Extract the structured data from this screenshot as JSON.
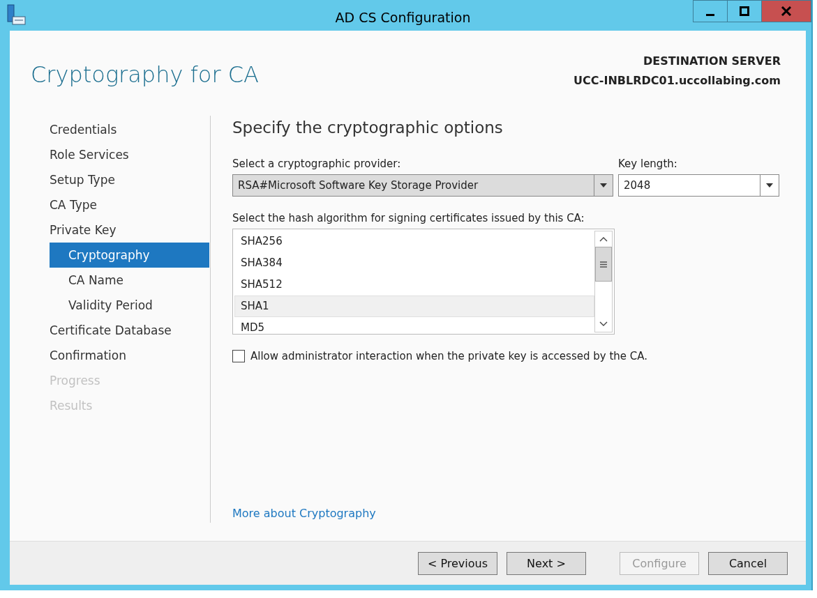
{
  "window": {
    "title": "AD CS Configuration"
  },
  "header": {
    "page_title": "Cryptography for CA",
    "destination_label": "DESTINATION SERVER",
    "server_name": "UCC-INBLRDC01.uccollabing.com"
  },
  "sidebar": {
    "items": [
      {
        "label": "Credentials",
        "selected": false,
        "disabled": false
      },
      {
        "label": "Role Services",
        "selected": false,
        "disabled": false
      },
      {
        "label": "Setup Type",
        "selected": false,
        "disabled": false
      },
      {
        "label": "CA Type",
        "selected": false,
        "disabled": false
      },
      {
        "label": "Private Key",
        "selected": false,
        "disabled": false,
        "children": [
          {
            "label": "Cryptography",
            "selected": true,
            "disabled": false
          },
          {
            "label": "CA Name",
            "selected": false,
            "disabled": false
          },
          {
            "label": "Validity Period",
            "selected": false,
            "disabled": false
          }
        ]
      },
      {
        "label": "Certificate Database",
        "selected": false,
        "disabled": false
      },
      {
        "label": "Confirmation",
        "selected": false,
        "disabled": false
      },
      {
        "label": "Progress",
        "selected": false,
        "disabled": true
      },
      {
        "label": "Results",
        "selected": false,
        "disabled": true
      }
    ]
  },
  "content": {
    "heading": "Specify the cryptographic options",
    "provider": {
      "label": "Select a cryptographic provider:",
      "value": "RSA#Microsoft Software Key Storage Provider"
    },
    "key_length": {
      "label": "Key length:",
      "value": "2048"
    },
    "hash": {
      "label": "Select the hash algorithm for signing certificates issued by this CA:",
      "items": [
        {
          "label": "SHA256",
          "selected": false
        },
        {
          "label": "SHA384",
          "selected": false
        },
        {
          "label": "SHA512",
          "selected": false
        },
        {
          "label": "SHA1",
          "selected": true
        },
        {
          "label": "MD5",
          "selected": false
        }
      ]
    },
    "allow_interaction": {
      "label": "Allow administrator interaction when the private key is accessed by the CA.",
      "checked": false
    },
    "link": "More about Cryptography"
  },
  "buttons": [
    {
      "label": "< Previous",
      "disabled": false
    },
    {
      "label": "Next >",
      "disabled": false
    },
    {
      "label": "Configure",
      "disabled": true
    },
    {
      "label": "Cancel",
      "disabled": false
    }
  ]
}
